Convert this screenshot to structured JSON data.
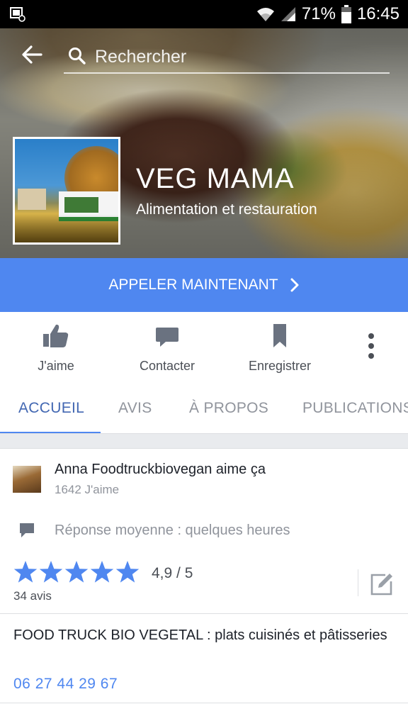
{
  "status_bar": {
    "battery": "71%",
    "time": "16:45",
    "icons": [
      "notification-icon",
      "wifi-icon",
      "signal-icon",
      "battery-icon"
    ]
  },
  "header": {
    "back_icon": "back-arrow-icon",
    "search_placeholder": "Rechercher"
  },
  "profile": {
    "name": "VEG MAMA",
    "category": "Alimentation et restauration"
  },
  "call_button": {
    "label": "APPELER MAINTENANT"
  },
  "actions": [
    {
      "label": "J'aime",
      "icon": "thumbs-up-icon"
    },
    {
      "label": "Contacter",
      "icon": "message-icon"
    },
    {
      "label": "Enregistrer",
      "icon": "bookmark-icon"
    }
  ],
  "tabs": [
    {
      "label": "ACCUEIL",
      "active": true
    },
    {
      "label": "AVIS",
      "active": false
    },
    {
      "label": "À PROPOS",
      "active": false
    },
    {
      "label": "PUBLICATIONS",
      "active": false
    }
  ],
  "info": {
    "likes_text": "Anna Foodtruckbiovegan aime ça",
    "likes_count": "1642 J'aime",
    "response_text": "Réponse moyenne : quelques heures",
    "rating": {
      "stars": 5,
      "value": "4,9 / 5",
      "reviews": "34 avis"
    },
    "description": "FOOD TRUCK BIO VEGETAL : plats cuisinés et pâtisseries",
    "phone": "06 27 44 29 67"
  },
  "colors": {
    "accent": "#4f87f0",
    "tab_active": "#4267b2",
    "text_muted": "#90949c"
  }
}
